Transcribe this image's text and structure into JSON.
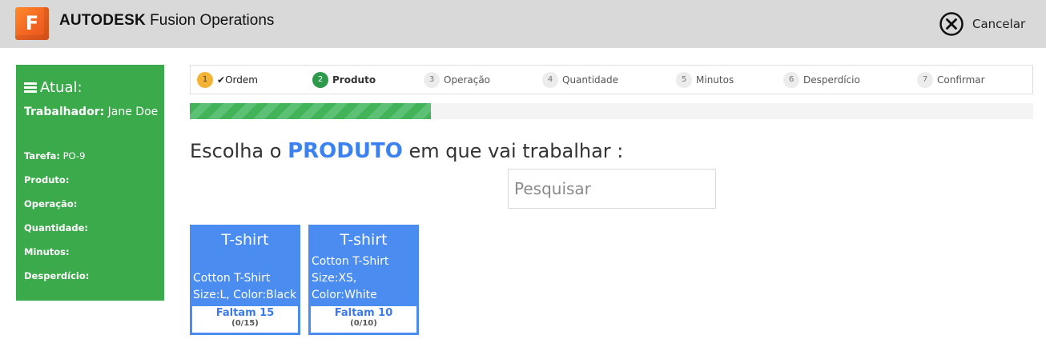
{
  "header": {
    "logo_letter": "F",
    "brand": "AUTODESK",
    "product": "Fusion Operations",
    "cancel_label": "Cancelar"
  },
  "sidebar": {
    "title": "Atual:",
    "worker_label": "Trabalhador",
    "worker_value": "Jane Doe",
    "fields": [
      {
        "label": "Tarefa",
        "value": "PO-9"
      },
      {
        "label": "Produto",
        "value": ""
      },
      {
        "label": "Operação",
        "value": ""
      },
      {
        "label": "Quantidade",
        "value": ""
      },
      {
        "label": "Minutos",
        "value": ""
      },
      {
        "label": "Desperdício",
        "value": ""
      }
    ]
  },
  "steps": [
    {
      "num": "1",
      "label": "Ordem",
      "check": "✔",
      "state": "done"
    },
    {
      "num": "2",
      "label": "Produto",
      "state": "active"
    },
    {
      "num": "3",
      "label": "Operação",
      "state": "pending"
    },
    {
      "num": "4",
      "label": "Quantidade",
      "state": "pending"
    },
    {
      "num": "5",
      "label": "Minutos",
      "state": "pending"
    },
    {
      "num": "6",
      "label": "Desperdício",
      "state": "pending"
    },
    {
      "num": "7",
      "label": "Confirmar",
      "state": "pending"
    }
  ],
  "progress": {
    "fraction": 0.286
  },
  "heading": {
    "prefix": "Escolha o",
    "strong": "PRODUTO",
    "suffix": "em que vai trabalhar :"
  },
  "search": {
    "placeholder": "Pesquisar",
    "value": ""
  },
  "products": [
    {
      "title": "T-shirt",
      "lines": [
        "Cotton T-Shirt",
        "Size:L, Color:Black"
      ],
      "remaining": "Faltam 15",
      "count": "(0/15)"
    },
    {
      "title": "T-shirt",
      "lines": [
        "Cotton T-Shirt",
        "Size:XS,",
        "Color:White"
      ],
      "remaining": "Faltam 10",
      "count": "(0/10)"
    }
  ],
  "colors": {
    "accent_blue": "#4a8cf0",
    "sidebar_green": "#3aaa4a",
    "step_done": "#f5b335",
    "step_active": "#2c9a4a",
    "logo_orange": "#f26522"
  }
}
